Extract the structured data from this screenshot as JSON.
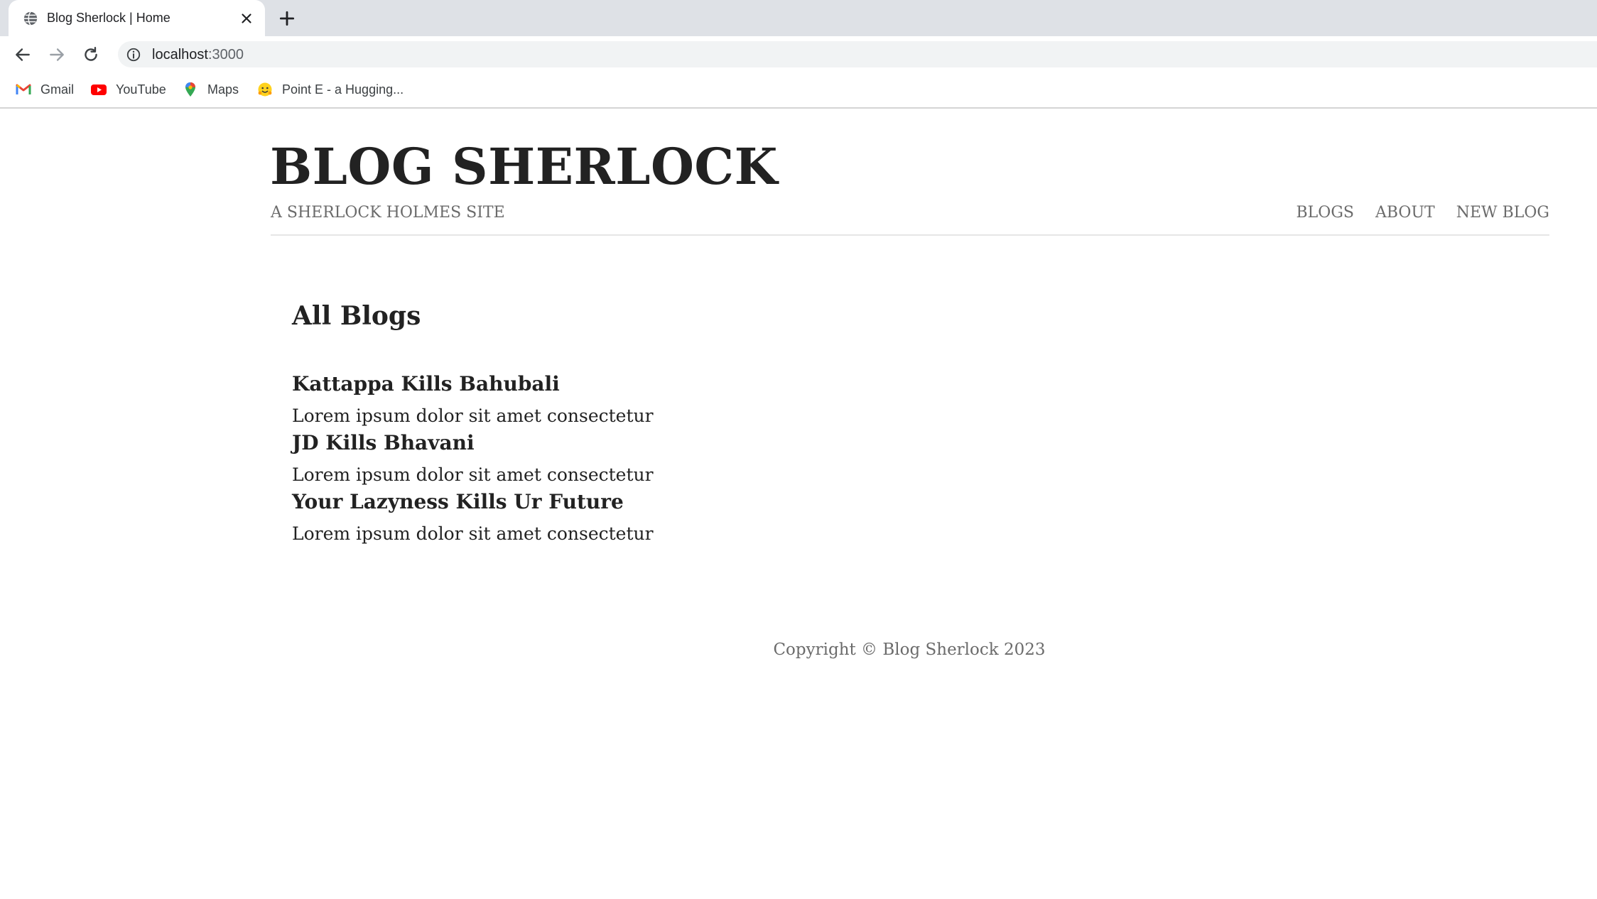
{
  "browser": {
    "tab": {
      "title": "Blog Sherlock | Home"
    },
    "address": {
      "host": "localhost",
      "port": ":3000"
    },
    "bookmarks": [
      {
        "label": "Gmail",
        "icon": "gmail-icon"
      },
      {
        "label": "YouTube",
        "icon": "youtube-icon"
      },
      {
        "label": "Maps",
        "icon": "maps-icon"
      },
      {
        "label": "Point E - a Hugging...",
        "icon": "hugging-face-icon"
      }
    ]
  },
  "site": {
    "title": "BLOG SHERLOCK",
    "subtitle": "A SHERLOCK HOLMES SITE",
    "nav": [
      "BLOGS",
      "ABOUT",
      "NEW BLOG"
    ]
  },
  "main": {
    "heading": "All Blogs",
    "blogs": [
      {
        "title": "Kattappa Kills Bahubali",
        "snippet": "Lorem ipsum dolor sit amet consectetur"
      },
      {
        "title": "JD Kills Bhavani",
        "snippet": "Lorem ipsum dolor sit amet consectetur"
      },
      {
        "title": "Your Lazyness Kills Ur Future",
        "snippet": "Lorem ipsum dolor sit amet consectetur"
      }
    ]
  },
  "footer": {
    "text": "Copyright © Blog Sherlock 2023"
  },
  "colors": {
    "chrome_bg": "#dee1e6",
    "text_dark": "#222222",
    "text_muted": "#6b6b6b"
  }
}
